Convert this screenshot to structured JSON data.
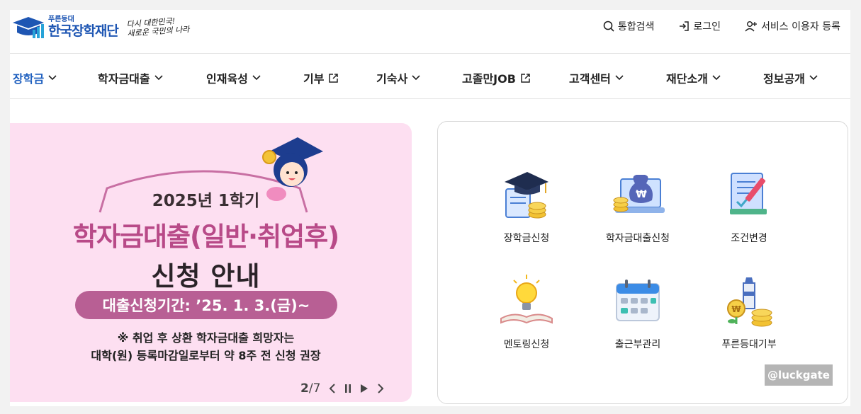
{
  "header": {
    "logo_small": "푸른등대",
    "logo_big": "한국장학재단",
    "slogan_line1": "다시 대한민국!",
    "slogan_line2": "새로운 국민의 나라",
    "utils": [
      {
        "label": "통합검색",
        "icon": "search-icon"
      },
      {
        "label": "로그인",
        "icon": "login-icon"
      },
      {
        "label": "서비스 이용자 등록",
        "icon": "user-add-icon"
      }
    ]
  },
  "gnb": {
    "items": [
      {
        "label": "장학금",
        "icon": "chevron-down-icon"
      },
      {
        "label": "학자금대출",
        "icon": "chevron-down-icon"
      },
      {
        "label": "인재육성",
        "icon": "chevron-down-icon"
      },
      {
        "label": "기부",
        "icon": "external-link-icon"
      },
      {
        "label": "기숙사",
        "icon": "chevron-down-icon"
      },
      {
        "label": "고졸만JOB",
        "icon": "external-link-icon"
      },
      {
        "label": "고객센터",
        "icon": "chevron-down-icon"
      },
      {
        "label": "재단소개",
        "icon": "chevron-down-icon"
      },
      {
        "label": "정보공개",
        "icon": "chevron-down-icon"
      }
    ]
  },
  "banner": {
    "year": "2025년 1학기",
    "title": "학자금대출(일반·취업후)",
    "subtitle": "신청 안내",
    "period": "대출신청기간: ’25. 1. 3.(금)~",
    "note1": "※  취업 후 상환 학자금대출 희망자는",
    "note2": "대학(원) 등록마감일로부터 약 8주 전 신청 권장",
    "pager_current": "2",
    "pager_total": "/7"
  },
  "quick_menu": {
    "items": [
      {
        "label": "장학금신청",
        "icon": "graduation-cap-coins-icon"
      },
      {
        "label": "학자금대출신청",
        "icon": "money-bag-laptop-icon"
      },
      {
        "label": "조건변경",
        "icon": "document-pen-icon"
      },
      {
        "label": "멘토링신청",
        "icon": "lightbulb-book-icon"
      },
      {
        "label": "출근부관리",
        "icon": "calendar-icon"
      },
      {
        "label": "푸른등대기부",
        "icon": "lighthouse-coins-icon"
      }
    ]
  },
  "watermark": "@luckgate",
  "colors": {
    "brand_blue": "#1e56b3",
    "banner_bg": "#fddff1",
    "banner_accent": "#b84a88"
  }
}
